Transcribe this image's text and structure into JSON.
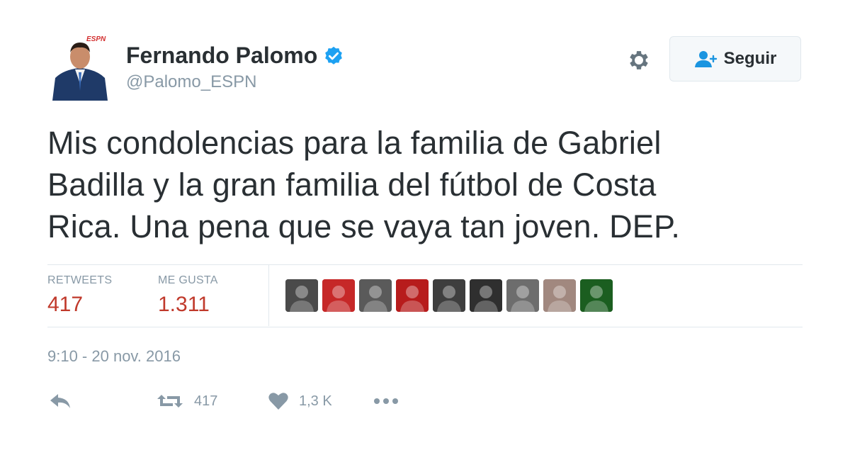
{
  "user": {
    "name": "Fernando Palomo",
    "handle": "@Palomo_ESPN",
    "verified_icon": "verified-badge-icon",
    "avatar_logo": "ESPN"
  },
  "header": {
    "follow_label": "Seguir",
    "gear_icon": "gear-icon"
  },
  "tweet": {
    "lines": [
      "Mis condolencias para la familia de Gabriel",
      "Badilla y la gran familia del fútbol de Costa",
      "Rica. Una pena que se vaya tan joven. DEP."
    ],
    "timestamp": "9:10 - 20 nov. 2016"
  },
  "stats": {
    "retweets_label": "RETWEETS",
    "retweets_value": "417",
    "likes_label": "ME GUSTA",
    "likes_value": "1.311"
  },
  "likers": [
    {
      "name": "liker-1",
      "color": "#4a4a4a"
    },
    {
      "name": "liker-2",
      "color": "#c62828"
    },
    {
      "name": "liker-3",
      "color": "#5a5a5a"
    },
    {
      "name": "liker-4",
      "color": "#b71c1c"
    },
    {
      "name": "liker-5",
      "color": "#3e3e3e"
    },
    {
      "name": "liker-6",
      "color": "#2f2f2f"
    },
    {
      "name": "liker-7",
      "color": "#6d6d6d"
    },
    {
      "name": "liker-8",
      "color": "#a1887f"
    },
    {
      "name": "liker-9",
      "color": "#1b5e20"
    }
  ],
  "actions": {
    "reply_icon": "reply-icon",
    "retweet_icon": "retweet-icon",
    "retweet_count": "417",
    "like_icon": "heart-icon",
    "like_count": "1,3 K",
    "more_icon": "more-icon"
  },
  "colors": {
    "text": "#292f33",
    "muted": "#8899a6",
    "stat_value": "#c0392b",
    "verified": "#1da1f2",
    "follow_icon": "#1b95e0"
  }
}
